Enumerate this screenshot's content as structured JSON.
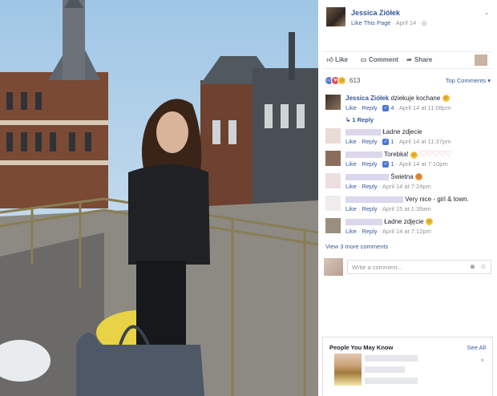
{
  "post": {
    "page_name": "Jessica Ziółek",
    "like_page": "Like This Page",
    "date": "April 14",
    "sep": "·",
    "globe_icon": "globe-icon"
  },
  "actions": {
    "like": "Like",
    "comment": "Comment",
    "share": "Share"
  },
  "reactions": {
    "count": "613",
    "top_comments": "Top Comments ▾"
  },
  "comments": [
    {
      "name": "Jessica Ziółek",
      "text": "dziekuje kochane",
      "like": "Like",
      "reply": "Reply",
      "likes": "4",
      "time": "April 14 at 11:08pm",
      "replies": "1 Reply"
    },
    {
      "name": "",
      "text": "Ładne zdjecie",
      "like": "Like",
      "reply": "Reply",
      "likes": "1",
      "time": "April 14 at 11:37pm"
    },
    {
      "name": "",
      "text": "Torebka!",
      "like": "Like",
      "reply": "Reply",
      "likes": "1",
      "time": "April 14 at 7:10pm"
    },
    {
      "name": "",
      "text": "Świetna",
      "like": "Like",
      "reply": "Reply",
      "time": "April 14 at 7:24pm"
    },
    {
      "name": "",
      "text": "Very nice - girl & town.",
      "like": "Like",
      "reply": "Reply",
      "time": "April 15 at 1:39am"
    },
    {
      "name": "",
      "text": "Ładne zdjęcie",
      "like": "Like",
      "reply": "Reply",
      "time": "April 14 at 7:12pm"
    }
  ],
  "more_comments": "View 3 more comments",
  "write": {
    "placeholder": "Write a comment..."
  },
  "pymk": {
    "title": "People You May Know",
    "see_all": "See All",
    "close": "×"
  },
  "icons": [
    "thumbs-up-icon",
    "comment-icon",
    "share-icon",
    "camera-icon",
    "emoji-icon",
    "chevron-down-icon"
  ]
}
